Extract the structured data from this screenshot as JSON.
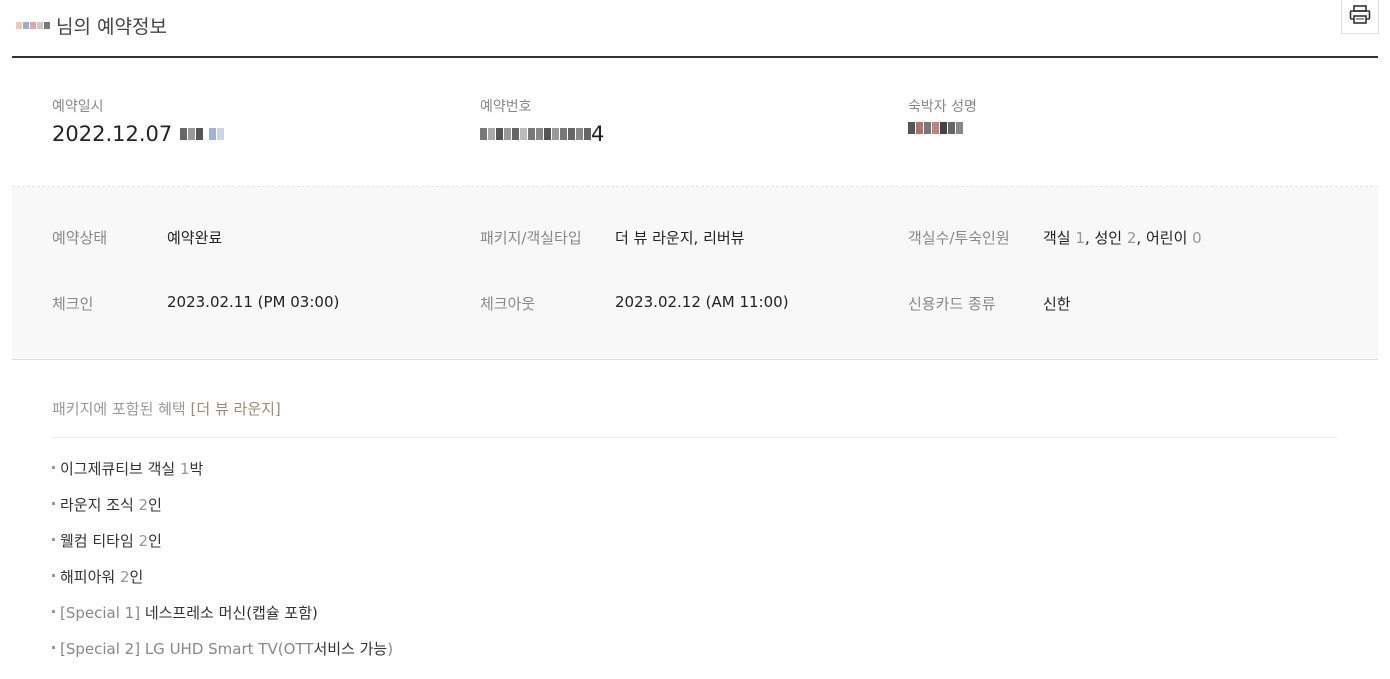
{
  "header": {
    "title_suffix": "님의 예약정보",
    "print_icon": "printer-icon"
  },
  "summary": {
    "reservation_date_label": "예약일시",
    "reservation_date_value": "2022.12.07",
    "reservation_number_label": "예약번호",
    "reservation_number_tail": "4",
    "guest_name_label": "숙박자 성명"
  },
  "details": {
    "status_label": "예약상태",
    "status_value": "예약완료",
    "package_label": "패키지/객실타입",
    "package_value": "더 뷰 라운지, 리버뷰",
    "rooms_label": "객실수/투숙인원",
    "rooms_text": {
      "room": "객실",
      "room_n": "1",
      "adult": "성인",
      "adult_n": "2",
      "child": "어린이",
      "child_n": "0"
    },
    "checkin_label": "체크인",
    "checkin_value": "2023.02.11 (PM 03:00)",
    "checkout_label": "체크아웃",
    "checkout_value": "2023.02.12 (AM 11:00)",
    "card_label": "신용카드 종류",
    "card_value": "신한"
  },
  "package": {
    "title_prefix": "패키지에 포함된 혜택",
    "title_name": "[더 뷰 라운지]",
    "benefits": [
      {
        "pre": "",
        "text": "이그제큐티브 객실 ",
        "num": "1",
        "post": "박"
      },
      {
        "pre": "",
        "text": "라운지 조식 ",
        "num": "2",
        "post": "인"
      },
      {
        "pre": "",
        "text": "웰컴 티타임 ",
        "num": "2",
        "post": "인"
      },
      {
        "pre": "",
        "text": "해피아워 ",
        "num": "2",
        "post": "인"
      },
      {
        "pre": "[Special 1]",
        "text": " 네스프레소 머신(캡슐 포함)",
        "num": "",
        "post": ""
      },
      {
        "pre": "[Special 2] LG UHD Smart TV(OTT",
        "text": "서비스 가능",
        "num": "",
        "post": ")"
      }
    ]
  },
  "colors": {
    "accent": "#a08a6e",
    "label": "#888888",
    "panel_bg": "#f8f8f8",
    "header_rule": "#333333"
  }
}
